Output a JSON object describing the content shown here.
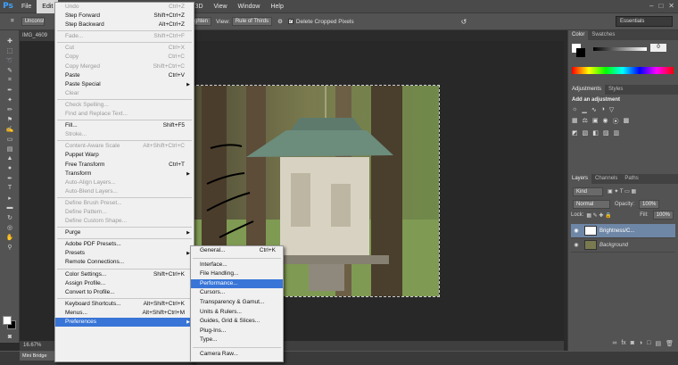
{
  "app": {
    "logo": "Ps"
  },
  "menubar": {
    "items": [
      "File",
      "Edit",
      "Image",
      "Layer",
      "Type",
      "Select",
      "Filter",
      "3D",
      "View",
      "Window",
      "Help"
    ]
  },
  "options_bar": {
    "preset": "Unconst",
    "straighten": "Straighten",
    "view_label": "View:",
    "view_value": "Rule of Thirds",
    "delete_pixels": "Delete Cropped Pixels",
    "workspace": "Essentials"
  },
  "document": {
    "tab": "IMG_4609",
    "zoom": "16.67%"
  },
  "mini_bridge": "Mini Bridge",
  "edit_menu": {
    "groups": [
      [
        {
          "label": "Undo",
          "shortcut": "Ctrl+Z",
          "disabled": true
        },
        {
          "label": "Step Forward",
          "shortcut": "Shift+Ctrl+Z",
          "disabled": false
        },
        {
          "label": "Step Backward",
          "shortcut": "Alt+Ctrl+Z",
          "disabled": false
        }
      ],
      [
        {
          "label": "Fade...",
          "shortcut": "Shift+Ctrl+F",
          "disabled": true
        }
      ],
      [
        {
          "label": "Cut",
          "shortcut": "Ctrl+X",
          "disabled": true
        },
        {
          "label": "Copy",
          "shortcut": "Ctrl+C",
          "disabled": true
        },
        {
          "label": "Copy Merged",
          "shortcut": "Shift+Ctrl+C",
          "disabled": true
        },
        {
          "label": "Paste",
          "shortcut": "Ctrl+V",
          "disabled": false
        },
        {
          "label": "Paste Special",
          "shortcut": "",
          "disabled": false,
          "submenu": true
        },
        {
          "label": "Clear",
          "shortcut": "",
          "disabled": true
        }
      ],
      [
        {
          "label": "Check Spelling...",
          "shortcut": "",
          "disabled": true
        },
        {
          "label": "Find and Replace Text...",
          "shortcut": "",
          "disabled": true
        }
      ],
      [
        {
          "label": "Fill...",
          "shortcut": "Shift+F5",
          "disabled": false
        },
        {
          "label": "Stroke...",
          "shortcut": "",
          "disabled": true
        }
      ],
      [
        {
          "label": "Content-Aware Scale",
          "shortcut": "Alt+Shift+Ctrl+C",
          "disabled": true
        },
        {
          "label": "Puppet Warp",
          "shortcut": "",
          "disabled": false
        },
        {
          "label": "Free Transform",
          "shortcut": "Ctrl+T",
          "disabled": false
        },
        {
          "label": "Transform",
          "shortcut": "",
          "disabled": false,
          "submenu": true
        },
        {
          "label": "Auto-Align Layers...",
          "shortcut": "",
          "disabled": true
        },
        {
          "label": "Auto-Blend Layers...",
          "shortcut": "",
          "disabled": true
        }
      ],
      [
        {
          "label": "Define Brush Preset...",
          "shortcut": "",
          "disabled": true
        },
        {
          "label": "Define Pattern...",
          "shortcut": "",
          "disabled": true
        },
        {
          "label": "Define Custom Shape...",
          "shortcut": "",
          "disabled": true
        }
      ],
      [
        {
          "label": "Purge",
          "shortcut": "",
          "disabled": false,
          "submenu": true
        }
      ],
      [
        {
          "label": "Adobe PDF Presets...",
          "shortcut": "",
          "disabled": false
        },
        {
          "label": "Presets",
          "shortcut": "",
          "disabled": false,
          "submenu": true
        },
        {
          "label": "Remote Connections...",
          "shortcut": "",
          "disabled": false
        }
      ],
      [
        {
          "label": "Color Settings...",
          "shortcut": "Shift+Ctrl+K",
          "disabled": false
        },
        {
          "label": "Assign Profile...",
          "shortcut": "",
          "disabled": false
        },
        {
          "label": "Convert to Profile...",
          "shortcut": "",
          "disabled": false
        }
      ],
      [
        {
          "label": "Keyboard Shortcuts...",
          "shortcut": "Alt+Shift+Ctrl+K",
          "disabled": false
        },
        {
          "label": "Menus...",
          "shortcut": "Alt+Shift+Ctrl+M",
          "disabled": false
        },
        {
          "label": "Preferences",
          "shortcut": "",
          "disabled": false,
          "submenu": true,
          "highlighted": true
        }
      ]
    ]
  },
  "preferences_submenu": {
    "groups": [
      [
        {
          "label": "General...",
          "shortcut": "Ctrl+K"
        }
      ],
      [
        {
          "label": "Interface...",
          "shortcut": ""
        },
        {
          "label": "File Handling...",
          "shortcut": ""
        },
        {
          "label": "Performance...",
          "shortcut": "",
          "highlighted": true
        },
        {
          "label": "Cursors...",
          "shortcut": ""
        },
        {
          "label": "Transparency & Gamut...",
          "shortcut": ""
        },
        {
          "label": "Units & Rulers...",
          "shortcut": ""
        },
        {
          "label": "Guides, Grid & Slices...",
          "shortcut": ""
        },
        {
          "label": "Plug-Ins...",
          "shortcut": ""
        },
        {
          "label": "Type...",
          "shortcut": ""
        }
      ],
      [
        {
          "label": "Camera Raw...",
          "shortcut": ""
        }
      ]
    ]
  },
  "panels": {
    "color": {
      "tabs": [
        "Color",
        "Swatches"
      ],
      "value": "0"
    },
    "adjustments": {
      "tabs": [
        "Adjustments",
        "Styles"
      ],
      "heading": "Add an adjustment"
    },
    "layers": {
      "tabs": [
        "Layers",
        "Channels",
        "Paths"
      ],
      "kind": "Kind",
      "blend_mode": "Normal",
      "opacity_label": "Opacity:",
      "opacity": "100%",
      "lock_label": "Lock:",
      "fill_label": "Fill:",
      "fill": "100%",
      "rows": [
        {
          "name": "Brightness/C...",
          "selected": true
        },
        {
          "name": "Background",
          "selected": false
        }
      ]
    }
  }
}
